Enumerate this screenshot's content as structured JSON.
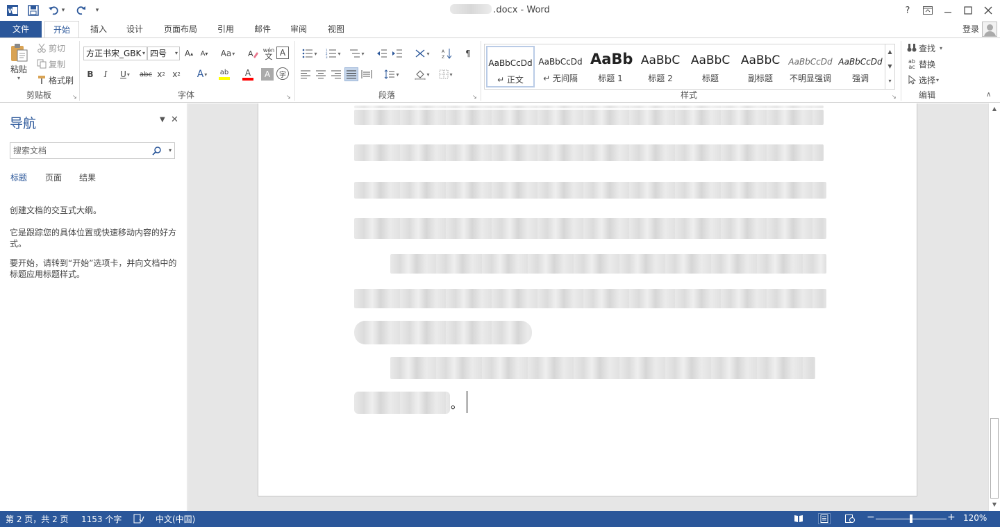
{
  "window": {
    "title_suffix": ".docx - Word",
    "controls": {
      "help": "?",
      "restore_ribbon": "⊡",
      "minimize": "—",
      "maximize": "☐",
      "close": "✕"
    }
  },
  "quick_access": {
    "undo_dropdown": "▾",
    "customize": "▾"
  },
  "tabs": {
    "file": "文件",
    "items": [
      "开始",
      "插入",
      "设计",
      "页面布局",
      "引用",
      "邮件",
      "审阅",
      "视图"
    ],
    "active": "开始"
  },
  "account": {
    "login": "登录"
  },
  "ribbon": {
    "clipboard": {
      "label": "剪贴板",
      "paste": "粘贴",
      "cut": "剪切",
      "copy": "复制",
      "format_painter": "格式刷"
    },
    "font": {
      "label": "字体",
      "font_name": "方正书宋_GBK",
      "font_size": "四号",
      "grow": "A",
      "shrink": "A",
      "change_case": "Aa",
      "bold": "B",
      "italic": "I",
      "underline": "U",
      "strike": "abc",
      "subscript": "x",
      "superscript": "x",
      "text_effect": "A",
      "highlight": "ab",
      "font_color": "A",
      "char_shading": "A",
      "enclose": "字",
      "phonetic": "wén",
      "char_border": "A",
      "highlight_color": "#ffff00",
      "font_color_value": "#ff0000"
    },
    "paragraph": {
      "label": "段落"
    },
    "styles": {
      "label": "样式",
      "items": [
        {
          "sample": "AaBbCcDd",
          "name": "↵ 正文"
        },
        {
          "sample": "AaBbCcDd",
          "name": "↵ 无间隔"
        },
        {
          "sample": "AaBb",
          "name": "标题 1"
        },
        {
          "sample": "AaBbC",
          "name": "标题 2"
        },
        {
          "sample": "AaBbC",
          "name": "标题"
        },
        {
          "sample": "AaBbC",
          "name": "副标题"
        },
        {
          "sample": "AaBbCcDd",
          "name": "不明显强调"
        },
        {
          "sample": "AaBbCcDd",
          "name": "强调"
        }
      ]
    },
    "editing": {
      "label": "编辑",
      "find": "查找",
      "replace": "替换",
      "select": "选择"
    }
  },
  "nav": {
    "title": "导航",
    "search_placeholder": "搜索文档",
    "tabs": [
      "标题",
      "页面",
      "结果"
    ],
    "active_tab": "标题",
    "help_lines": [
      "创建文档的交互式大纲。",
      "它是跟踪您的具体位置或快速移动内容的好方式。",
      "要开始，请转到“开始”选项卡，并向文档中的标题应用标题样式。"
    ]
  },
  "document": {
    "end_mark": "。"
  },
  "status": {
    "page": "第 2 页，共 2 页",
    "words": "1153 个字",
    "language": "中文(中国)",
    "zoom": "120%",
    "zoom_minus": "−",
    "zoom_plus": "+"
  },
  "colors": {
    "accent": "#2b579a",
    "status_bar": "#2b579a"
  }
}
